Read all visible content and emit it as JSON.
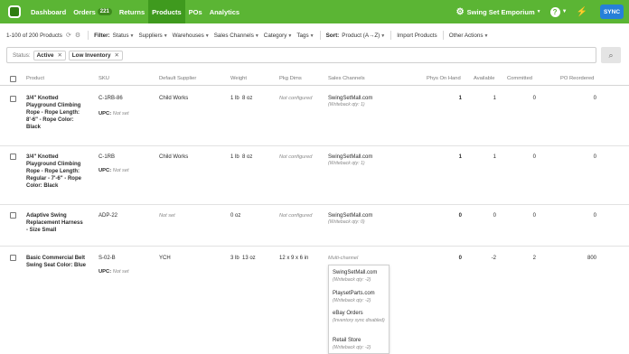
{
  "nav": {
    "items": [
      {
        "label": "Dashboard",
        "active": false
      },
      {
        "label": "Orders",
        "active": false,
        "badge": "221"
      },
      {
        "label": "Returns",
        "active": false
      },
      {
        "label": "Products",
        "active": true
      },
      {
        "label": "POs",
        "active": false
      },
      {
        "label": "Analytics",
        "active": false
      }
    ],
    "store_name": "Swing Set Emporium",
    "sync_label": "SYNC",
    "help_label": "?"
  },
  "toolbar": {
    "count": "1-100 of 200 Products",
    "filter_label": "Filter:",
    "filters": [
      "Status",
      "Suppliers",
      "Warehouses",
      "Sales Channels",
      "Category",
      "Tags"
    ],
    "sort_label": "Sort:",
    "sort_value": "Product (A→Z)",
    "import_label": "Import Products",
    "other_label": "Other Actions"
  },
  "filterbar": {
    "status_label": "Status:",
    "pills": [
      "Active",
      "Low Inventory"
    ]
  },
  "table": {
    "headers": [
      "Product",
      "SKU",
      "Default Supplier",
      "Weight",
      "Pkg Dims",
      "Sales Channels",
      "Phys On Hand",
      "Available",
      "Committed",
      "PO Reordered"
    ],
    "rows": [
      {
        "product": "3/4\" Knotted Playground Climbing Rope - Rope Length: 8'-6\" - Rope Color: Black",
        "sku": "C-1RB-86",
        "upc_label": "UPC:",
        "upc_value": "Not set",
        "supplier": "Child Works",
        "weight": "1 lb  8 oz",
        "dims": "Not configured",
        "channel": "SwingSetMall.com",
        "channel_sub": "(Writeback qty: 1)",
        "on_hand": "1",
        "available": "1",
        "committed": "0",
        "reordered": "0"
      },
      {
        "product": "3/4\" Knotted Playground Climbing Rope - Rope Length: Regular - 7'-6\" - Rope Color: Black",
        "sku": "C-1RB",
        "upc_label": "UPC:",
        "upc_value": "Not set",
        "supplier": "Child Works",
        "weight": "1 lb  8 oz",
        "dims": "Not configured",
        "channel": "SwingSetMall.com",
        "channel_sub": "(Writeback qty: 1)",
        "on_hand": "1",
        "available": "1",
        "committed": "0",
        "reordered": "0"
      },
      {
        "product": "Adaptive Swing Replacement Harness - Size Small",
        "sku": "ADP-22",
        "upc_label": "",
        "upc_value": "",
        "supplier": "Not set",
        "weight": "0 oz",
        "dims": "Not configured",
        "channel": "SwingSetMall.com",
        "channel_sub": "(Writeback qty: 0)",
        "on_hand": "0",
        "available": "0",
        "committed": "0",
        "reordered": "0"
      },
      {
        "product": "Basic Commercial Belt Swing Seat Color: Blue",
        "sku": "S-02-B",
        "upc_label": "UPC:",
        "upc_value": "Not set",
        "supplier": "YCH",
        "weight": "3 lb  13 oz",
        "dims": "12 x 9 x 6 in",
        "channel": "Multi-channel",
        "channel_sub": "",
        "on_hand": "0",
        "available": "-2",
        "committed": "2",
        "reordered": "800"
      }
    ]
  },
  "dropdown": {
    "items": [
      {
        "name": "SwingSetMall.com",
        "sub": "(Writeback qty: -2)"
      },
      {
        "name": "PlaysetParts.com",
        "sub": "(Writeback qty: -2)"
      },
      {
        "name": "eBay Orders",
        "sub": "(Inventory sync disabled)"
      },
      {
        "name": "Retail Store",
        "sub": "(Writeback qty: -2)"
      }
    ]
  },
  "icons": {
    "store": "gear-icon",
    "activity": "activity-icon",
    "search": "search-icon",
    "refresh": "refresh-icon",
    "settings": "settings-icon"
  },
  "colors": {
    "nav_bg": "#5bb534",
    "nav_active": "#3f9a1e",
    "sync_bg": "#2680d9"
  }
}
